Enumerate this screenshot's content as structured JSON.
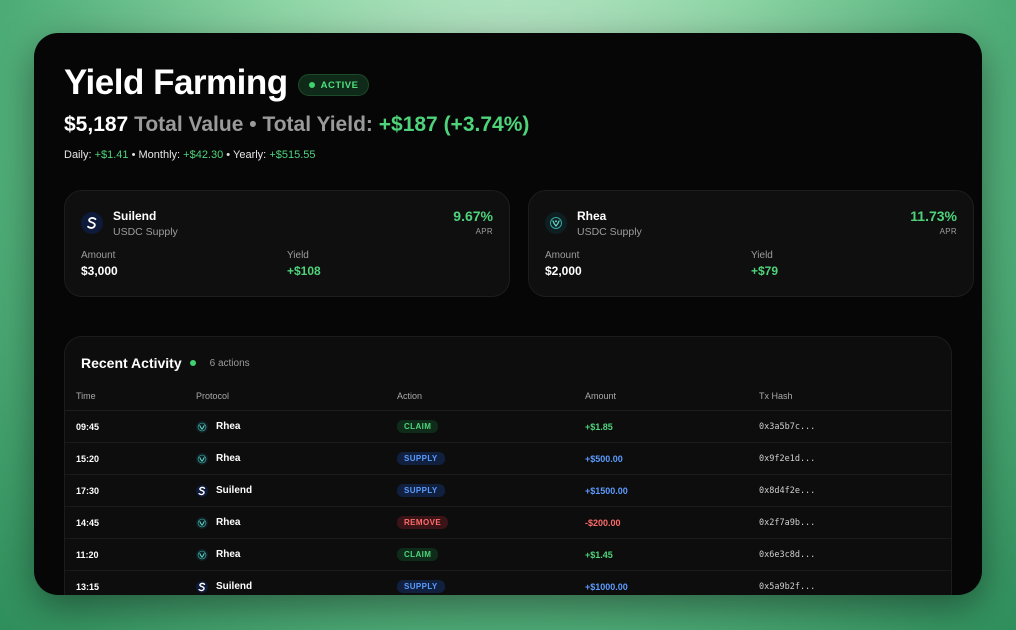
{
  "header": {
    "title": "Yield Farming",
    "status_badge": "ACTIVE",
    "total_value": "$5,187",
    "total_value_label": "Total Value",
    "separator": "•",
    "total_yield_label": "Total Yield:",
    "total_yield": "+$187 (+3.74%)",
    "daily_label": "Daily:",
    "daily_value": "+$1.41",
    "monthly_label": "Monthly:",
    "monthly_value": "+$42.30",
    "yearly_label": "Yearly:",
    "yearly_value": "+$515.55"
  },
  "positions": [
    {
      "protocol": "Suilend",
      "subtitle": "USDC Supply",
      "apr": "9.67%",
      "apr_label": "APR",
      "amount_label": "Amount",
      "amount": "$3,000",
      "yield_label": "Yield",
      "yield": "+$108",
      "icon": "suilend-logo-icon"
    },
    {
      "protocol": "Rhea",
      "subtitle": "USDC Supply",
      "apr": "11.73%",
      "apr_label": "APR",
      "amount_label": "Amount",
      "amount": "$2,000",
      "yield_label": "Yield",
      "yield": "+$79",
      "icon": "rhea-logo-icon"
    }
  ],
  "activity": {
    "title": "Recent Activity",
    "count": "6 actions",
    "columns": [
      "Time",
      "Protocol",
      "Action",
      "Amount",
      "Tx Hash"
    ],
    "rows": [
      {
        "time": "09:45",
        "protocol": "Rhea",
        "action": "CLAIM",
        "amount": "+$1.85",
        "hash": "0x3a5b7c..."
      },
      {
        "time": "15:20",
        "protocol": "Rhea",
        "action": "SUPPLY",
        "amount": "+$500.00",
        "hash": "0x9f2e1d..."
      },
      {
        "time": "17:30",
        "protocol": "Suilend",
        "action": "SUPPLY",
        "amount": "+$1500.00",
        "hash": "0x8d4f2e..."
      },
      {
        "time": "14:45",
        "protocol": "Rhea",
        "action": "REMOVE",
        "amount": "-$200.00",
        "hash": "0x2f7a9b..."
      },
      {
        "time": "11:20",
        "protocol": "Rhea",
        "action": "CLAIM",
        "amount": "+$1.45",
        "hash": "0x6e3c8d..."
      },
      {
        "time": "13:15",
        "protocol": "Suilend",
        "action": "SUPPLY",
        "amount": "+$1000.00",
        "hash": "0x5a9b2f..."
      }
    ]
  },
  "colors": {
    "positive": "#4ed37b",
    "supply": "#5b9bff",
    "negative": "#ff6b6b",
    "window_bg": "#060606"
  }
}
